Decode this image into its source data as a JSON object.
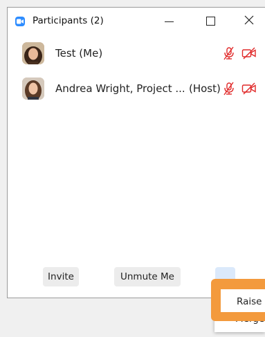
{
  "window": {
    "title": "Participants (2)"
  },
  "participants": [
    {
      "name": "Test (Me)",
      "role": "",
      "mic": "mic-muted-icon",
      "video": "video-off-icon"
    },
    {
      "name": "Andrea Wright, Project ...",
      "role": "(Host)",
      "mic": "mic-muted-icon",
      "video": "video-off-icon"
    }
  ],
  "footer": {
    "invite_label": "Invite",
    "unmute_label": "Unmute Me",
    "more_label": "..."
  },
  "more_menu": {
    "items": [
      "Raise H",
      "Merge"
    ]
  },
  "colors": {
    "accent": "#2d8cff",
    "muted_red": "#e02828",
    "highlight": "#f39a3d"
  }
}
